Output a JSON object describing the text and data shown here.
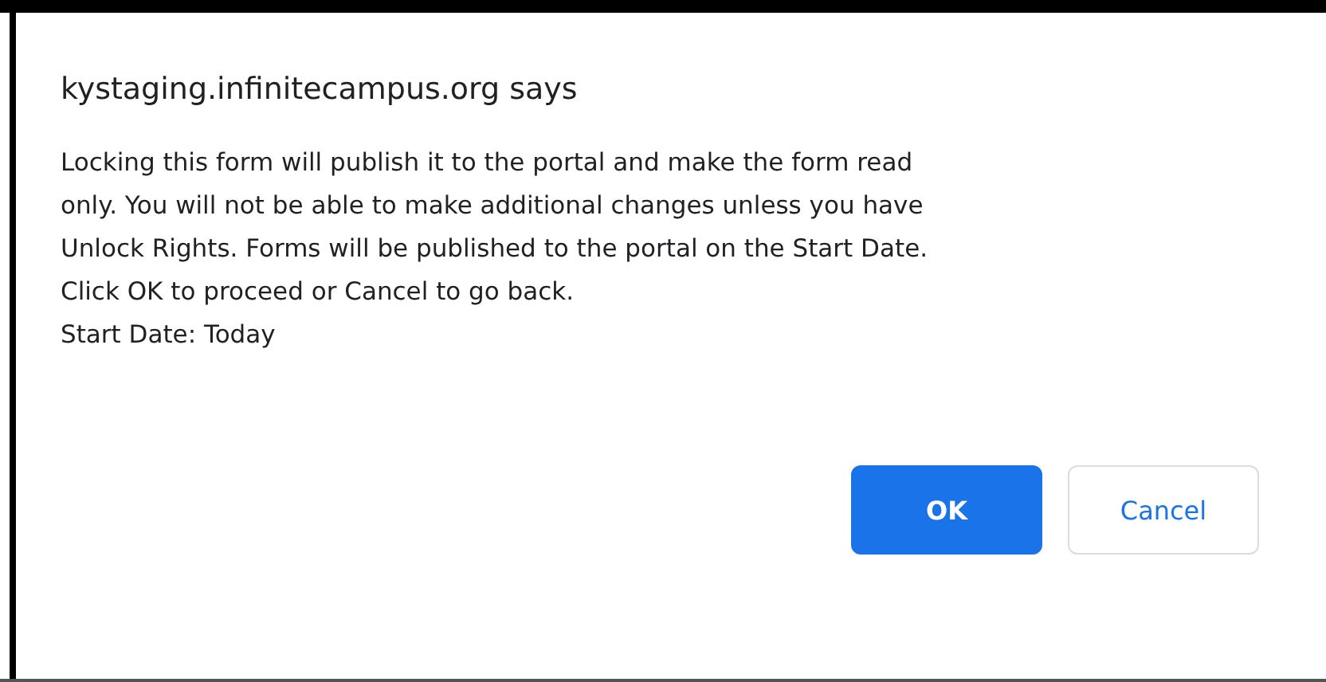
{
  "dialog": {
    "title": "kystaging.infinitecampus.org says",
    "message_lines": [
      "Locking this form will publish it to the portal and make the form read",
      "only. You will not be able to make additional changes unless you have",
      "Unlock Rights. Forms will be published to the portal on the Start Date.",
      "Click OK to proceed or Cancel to go back.",
      "Start Date: Today"
    ],
    "buttons": [
      {
        "label": "OK",
        "kind": "primary"
      },
      {
        "label": "Cancel",
        "kind": "secondary"
      }
    ]
  }
}
